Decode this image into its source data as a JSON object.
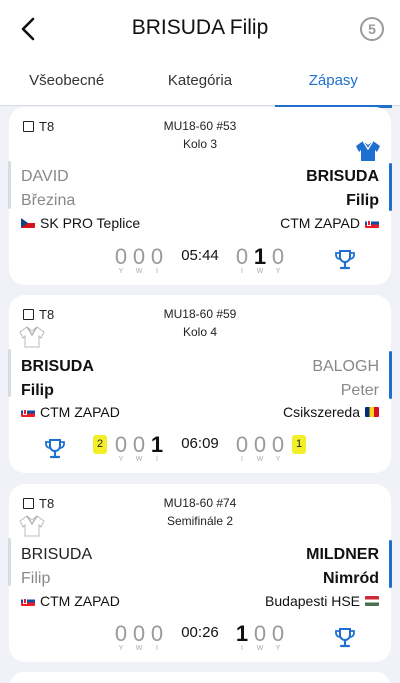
{
  "header": {
    "surname": "BRISUDA",
    "given": "Filip",
    "badge": "5"
  },
  "tabs": [
    {
      "label": "Všeobecné",
      "active": false
    },
    {
      "label": "Kategória",
      "active": false
    },
    {
      "label": "Zápasy",
      "active": true
    }
  ],
  "score_labels": {
    "left": [
      "Y",
      "W",
      "I"
    ],
    "right": [
      "I",
      "W",
      "Y"
    ]
  },
  "matches": [
    {
      "tatami": "T8",
      "category": "MU18-60 #53",
      "round": "Kolo 3",
      "left": {
        "surname": "DAVID",
        "given": "Březina",
        "club": "SK PRO Teplice",
        "flag": "cz"
      },
      "right": {
        "surname": "BRISUDA",
        "given": "Filip",
        "club": "CTM ZAPAD",
        "flag": "sk"
      },
      "left_score": [
        "0",
        "0",
        "0"
      ],
      "right_score": [
        "0",
        "1",
        "0"
      ],
      "time": "05:44",
      "winner": "right"
    },
    {
      "tatami": "T8",
      "category": "MU18-60 #59",
      "round": "Kolo 4",
      "left": {
        "surname": "BRISUDA",
        "given": "Filip",
        "club": "CTM ZAPAD",
        "flag": "sk"
      },
      "right": {
        "surname": "BALOGH",
        "given": "Peter",
        "club": "Csikszereda",
        "flag": "ro"
      },
      "left_shido": "2",
      "right_shido": "1",
      "left_score": [
        "0",
        "0",
        "1"
      ],
      "right_score": [
        "0",
        "0",
        "0"
      ],
      "time": "06:09",
      "winner": "left"
    },
    {
      "tatami": "T8",
      "category": "MU18-60 #74",
      "round": "Semifinále 2",
      "left": {
        "surname": "BRISUDA",
        "given": "Filip",
        "club": "CTM ZAPAD",
        "flag": "sk"
      },
      "right": {
        "surname": "MILDNER",
        "given": "Nimród",
        "club": "Budapesti HSE",
        "flag": "hu"
      },
      "left_score": [
        "0",
        "0",
        "0"
      ],
      "right_score": [
        "1",
        "0",
        "0"
      ],
      "time": "00:26",
      "winner": "right"
    }
  ],
  "colors": {
    "accent": "#1f6fd1",
    "shido": "#f2ee28",
    "muted": "#9a9a9a"
  }
}
